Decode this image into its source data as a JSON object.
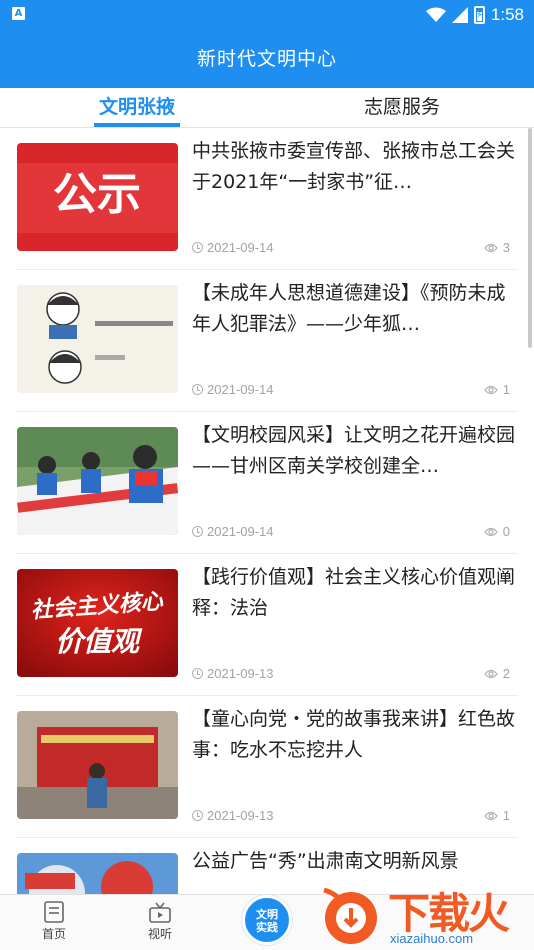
{
  "status_bar": {
    "time": "1:58",
    "app_badge": "A"
  },
  "header": {
    "title": "新时代文明中心"
  },
  "tabs": [
    {
      "label": "文明张掖",
      "active": true
    },
    {
      "label": "志愿服务",
      "active": false
    }
  ],
  "articles": [
    {
      "title": "中共张掖市委宣传部、张掖市总工会关于2021年“一封家书”征…",
      "date": "2021-09-14",
      "views": "3",
      "thumb": "公示"
    },
    {
      "title": "【未成年人思想道德建设】《预防未成年人犯罪法》——少年狐…",
      "date": "2021-09-14",
      "views": "1",
      "thumb": "cartoon"
    },
    {
      "title": "【文明校园风采】让文明之花开遍校园——甘州区南关学校创建全…",
      "date": "2021-09-14",
      "views": "0",
      "thumb": "students"
    },
    {
      "title": "【践行价值观】社会主义核心价值观阐释：法治",
      "date": "2021-09-13",
      "views": "2",
      "thumb": "社会主义核心价值观"
    },
    {
      "title": "【童心向党・党的故事我来讲】红色故事：吃水不忘挖井人",
      "date": "2021-09-13",
      "views": "1",
      "thumb": "红色故事"
    },
    {
      "title": "公益广告“秀”出肃南文明新风景",
      "date": "",
      "views": "",
      "thumb": "ad"
    }
  ],
  "bottom_nav": [
    {
      "label": "首页",
      "icon": "home-icon"
    },
    {
      "label": "视听",
      "icon": "video-icon"
    }
  ],
  "center_button": {
    "line1": "文明",
    "line2": "实践"
  },
  "watermark": {
    "brand": "下载火",
    "url": "xiazaihuo.com"
  },
  "colors": {
    "primary": "#1e8ff1",
    "watermark_orange": "#f15a22"
  }
}
